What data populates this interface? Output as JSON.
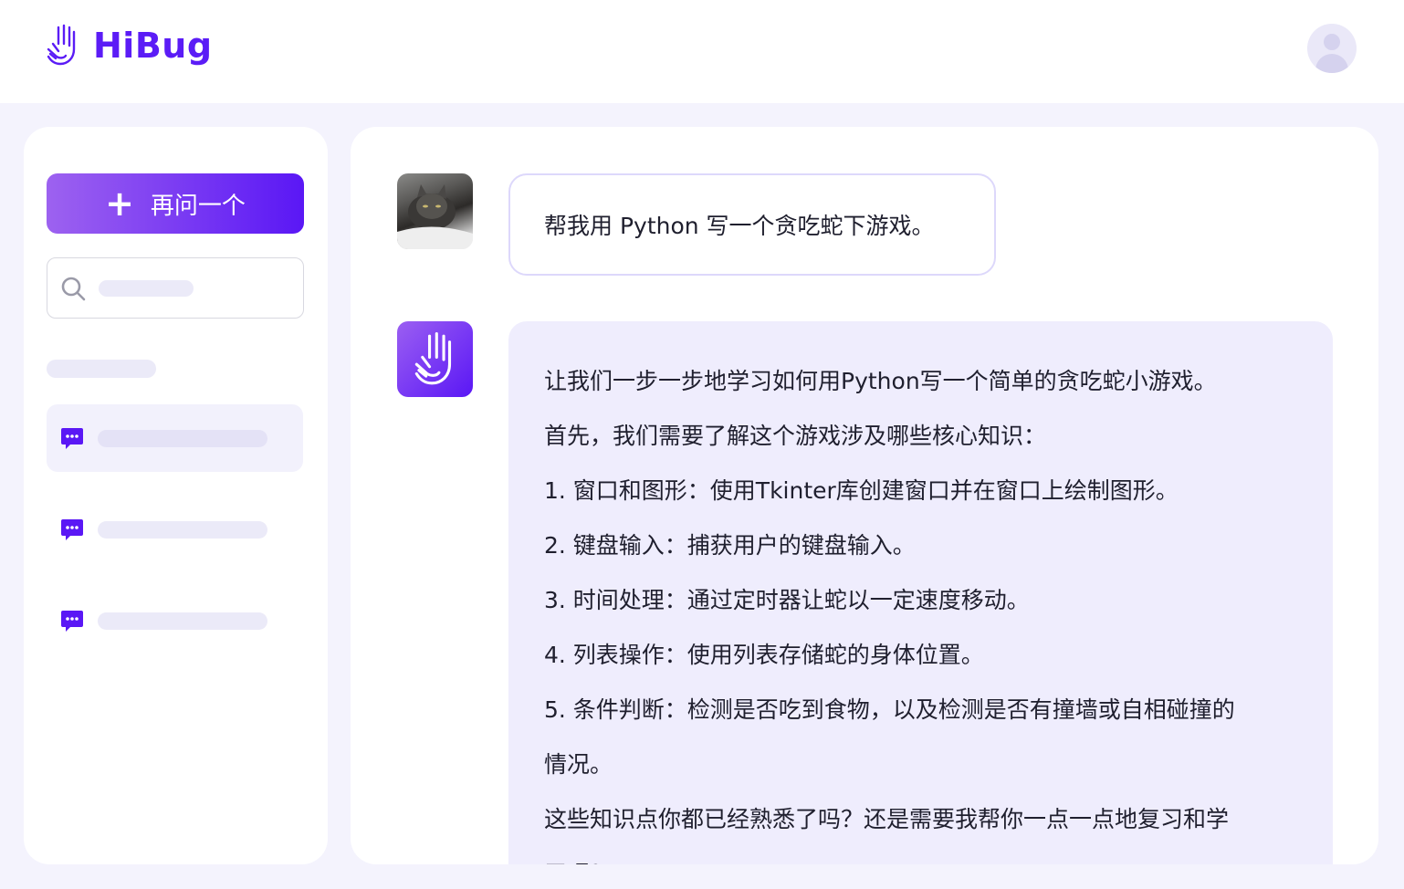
{
  "header": {
    "brand": "HiBug",
    "brand_color": "#5b1cf6",
    "logo_icon": "hand-icon",
    "user_avatar_icon": "user-icon"
  },
  "sidebar": {
    "new_button_icon": "plus-icon",
    "new_button_label": "再问一个",
    "search_icon": "search-icon",
    "chat_icon": "chat-bubble-icon",
    "chat_count": 3,
    "active_chat_index": 0
  },
  "conversation": {
    "user_message": "帮我用 Python 写一个贪吃蛇下游戏。",
    "bot_lines": [
      "让我们一步一步地学习如何用Python写一个简单的贪吃蛇小游戏。",
      "首先，我们需要了解这个游戏涉及哪些核心知识：",
      "1. 窗口和图形：使用Tkinter库创建窗口并在窗口上绘制图形。",
      "2. 键盘输入：捕获用户的键盘输入。",
      "3. 时间处理：通过定时器让蛇以一定速度移动。",
      "4. 列表操作：使用列表存储蛇的身体位置。",
      "5. 条件判断：检测是否吃到食物，以及检测是否有撞墙或自相碰撞的",
      "情况。",
      "这些知识点你都已经熟悉了吗？还是需要我帮你一点一点地复习和学",
      "习呢？"
    ]
  },
  "colors": {
    "accent": "#5a17f5",
    "accent_light": "#9d62f0",
    "bot_bubble_bg": "#efedfd",
    "page_bg": "#f4f3fd"
  }
}
